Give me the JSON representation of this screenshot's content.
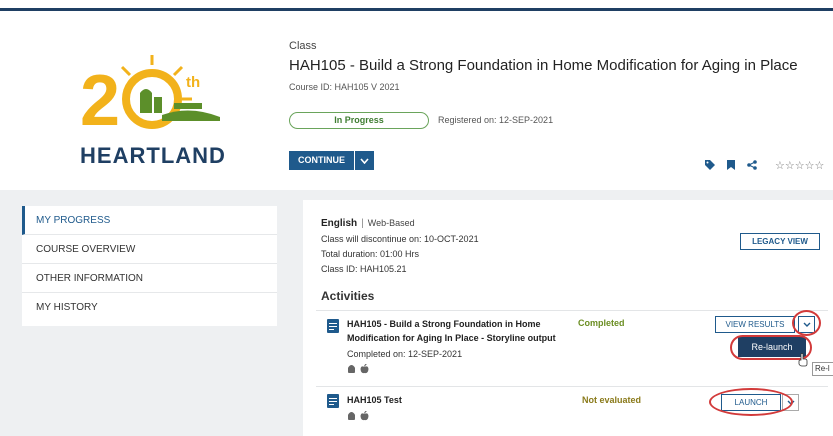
{
  "header": {
    "logo_text": "HEARTLAND",
    "type_label": "Class",
    "course_title": "HAH105 - Build a Strong Foundation in Home Modification for Aging in Place",
    "course_id": "Course ID: HAH105  V 2021",
    "status": "In Progress",
    "registered": "Registered on: 12-SEP-2021",
    "continue_label": "CONTINUE",
    "rating_stars": "☆☆☆☆☆"
  },
  "nav": {
    "items": [
      {
        "label": "MY PROGRESS"
      },
      {
        "label": "COURSE OVERVIEW"
      },
      {
        "label": "OTHER INFORMATION"
      },
      {
        "label": "MY HISTORY"
      }
    ]
  },
  "details": {
    "language": "English",
    "separator": "|",
    "delivery": "Web-Based",
    "discontinue": "Class will discontinue on:  10-OCT-2021",
    "duration": "Total duration: 01:00 Hrs",
    "class_id": "Class ID: HAH105.21",
    "legacy_label": "LEGACY VIEW",
    "activities_heading": "Activities"
  },
  "activities": [
    {
      "title_line1": "HAH105 - Build a Strong Foundation in Home",
      "title_line2": "Modification for Aging In Place - Storyline output",
      "completed_on": "Completed on: 12-SEP-2021",
      "status": "Completed",
      "action_label": "VIEW RESULTS",
      "menu_item": "Re-launch"
    },
    {
      "title_line1": "HAH105 Test",
      "status": "Not evaluated",
      "action_label": "LAUNCH"
    }
  ],
  "tooltip": "Re-l",
  "colors": {
    "brand": "#1f5a8c",
    "dark_navy": "#1f3f63",
    "success": "#3f7d32",
    "highlight": "#d23a3a"
  }
}
